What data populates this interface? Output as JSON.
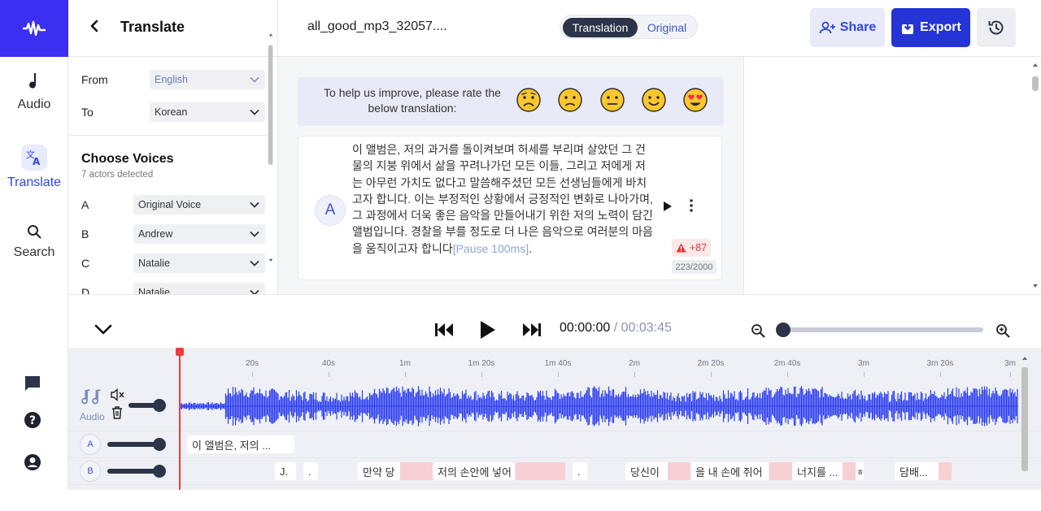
{
  "rail": {
    "items": [
      {
        "label": "Audio",
        "icon": "music-note-icon"
      },
      {
        "label": "Translate",
        "icon": "translate-icon",
        "active": true
      },
      {
        "label": "Search",
        "icon": "search-icon"
      }
    ],
    "bottom_icons": [
      "chat-icon",
      "help-icon",
      "account-icon"
    ]
  },
  "panel": {
    "title": "Translate",
    "from_label": "From",
    "from_value": "English",
    "to_label": "To",
    "to_value": "Korean",
    "voices_title": "Choose Voices",
    "voices_subtitle": "7 actors detected",
    "voices": [
      {
        "letter": "A",
        "voice": "Original Voice"
      },
      {
        "letter": "B",
        "voice": "Andrew"
      },
      {
        "letter": "C",
        "voice": "Natalie"
      },
      {
        "letter": "D",
        "voice": "Natalie"
      }
    ]
  },
  "header": {
    "filename": "all_good_mp3_32057....",
    "toggle_translation": "Translation",
    "toggle_original": "Original",
    "share_label": "Share",
    "export_label": "Export"
  },
  "rating": {
    "prompt": "To help us improve, please rate the below translation:",
    "options": [
      "very-sad-face-icon",
      "sad-face-icon",
      "neutral-face-icon",
      "smile-face-icon",
      "heart-eyes-face-icon"
    ]
  },
  "segment": {
    "speaker": "A",
    "text": "이 앨범은, 저의 과거를 돌이켜보며 허세를 부리며 살았던 그 건물의 지붕 위에서 삶을 꾸려나가던 모든 이들, 그리고 저에게 저는 아무런 가치도 없다고 말씀해주셨던 모든 선생님들에게 바치고자 합니다. 이는 부정적인 상황에서 긍정적인 변화로 나아가며, 그 과정에서 더욱 좋은 음악을 만들어내기 위한 저의 노력이 담긴 앨범입니다. 경찰을 부를 정도로 더 나은 음악으로 여러분의 마음을 움직이고자 합니다",
    "pause": "[Pause 100ms]",
    "end_punct": ".",
    "warning": "+87",
    "char_count": "223/2000"
  },
  "transport": {
    "current_time": "00:00:00",
    "separator": " / ",
    "total_time": "00:03:45"
  },
  "timeline": {
    "ruler": [
      "20s",
      "40s",
      "1m",
      "1m 20s",
      "1m 40s",
      "2m",
      "2m 20s",
      "2m 40s",
      "3m",
      "3m 20s",
      "3m"
    ],
    "audio_label": "Audio",
    "tracks": [
      {
        "letter": "A",
        "segments": [
          "이 앨범은, 저의 ..."
        ]
      },
      {
        "letter": "B",
        "segments": [
          "J.",
          ".",
          "만약 당",
          "저의 손안에 넣어",
          ".",
          "당신이",
          "을 내 손에 쥐어",
          "너지를 ...",
          "ㅎ",
          "담배..."
        ]
      }
    ]
  },
  "colors": {
    "brand": "#3b2ff0",
    "accent": "#2f46e6",
    "dark": "#2b3448",
    "waveform": "#2a3cf0",
    "playhead": "#ef3b3b",
    "warning": "#e0363a"
  }
}
